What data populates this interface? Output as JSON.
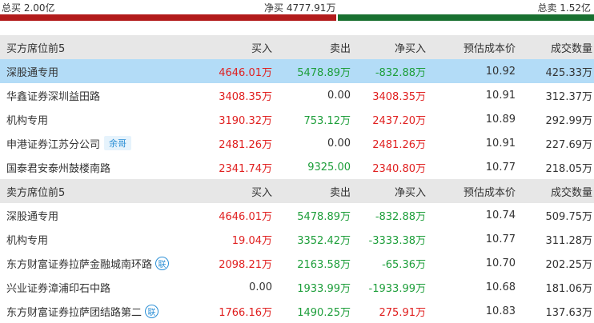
{
  "summary": {
    "buy_total": "总买 2.00亿",
    "net_buy": "净买 4777.91万",
    "sell_total": "总卖 1.52亿",
    "colors": {
      "buy": "#b21b1b",
      "sell": "#187030"
    }
  },
  "buy_section": {
    "headers": [
      "买方席位前5",
      "买入",
      "卖出",
      "净买入",
      "预估成本价",
      "成交数量"
    ],
    "rows": [
      {
        "name": "深股通专用",
        "buy": "4646.01万",
        "sell": "5478.89万",
        "net": "-832.88万",
        "cost": "10.92",
        "vol": "425.33万"
      },
      {
        "name": "华鑫证券深圳益田路",
        "buy": "3408.35万",
        "sell": "0.00",
        "net": "3408.35万",
        "cost": "10.91",
        "vol": "312.37万"
      },
      {
        "name": "机构专用",
        "buy": "3190.32万",
        "sell": "753.12万",
        "net": "2437.20万",
        "cost": "10.89",
        "vol": "292.99万"
      },
      {
        "name": "申港证券江苏分公司",
        "tag": "余哥",
        "buy": "2481.26万",
        "sell": "0.00",
        "net": "2481.26万",
        "cost": "10.91",
        "vol": "227.69万"
      },
      {
        "name": "国泰君安泰州鼓楼南路",
        "buy": "2341.74万",
        "sell": "9325.00",
        "net": "2340.80万",
        "cost": "10.77",
        "vol": "218.05万"
      }
    ]
  },
  "sell_section": {
    "headers": [
      "卖方席位前5",
      "买入",
      "卖出",
      "净买入",
      "预估成本价",
      "成交数量"
    ],
    "rows": [
      {
        "name": "深股通专用",
        "buy": "4646.01万",
        "sell": "5478.89万",
        "net": "-832.88万",
        "cost": "10.74",
        "vol": "509.75万"
      },
      {
        "name": "机构专用",
        "buy": "19.04万",
        "sell": "3352.42万",
        "net": "-3333.38万",
        "cost": "10.77",
        "vol": "311.28万"
      },
      {
        "name": "东方财富证券拉萨金融城南环路",
        "badge": "联",
        "buy": "2098.21万",
        "sell": "2163.58万",
        "net": "-65.36万",
        "cost": "10.70",
        "vol": "202.25万"
      },
      {
        "name": "兴业证券漳浦印石中路",
        "buy": "0.00",
        "sell": "1933.99万",
        "net": "-1933.99万",
        "cost": "10.68",
        "vol": "181.06万"
      },
      {
        "name": "东方财富证券拉萨团结路第二",
        "badge": "联",
        "buy": "1766.16万",
        "sell": "1490.25万",
        "net": "275.91万",
        "cost": "10.83",
        "vol": "137.63万"
      }
    ]
  }
}
